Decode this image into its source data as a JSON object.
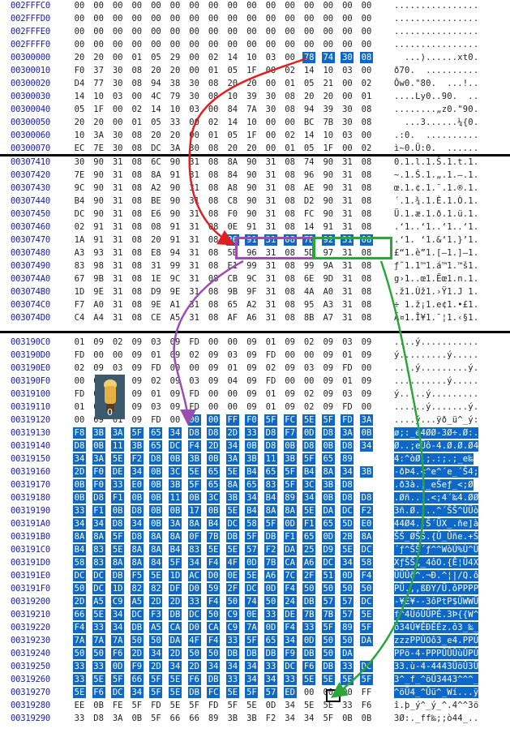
{
  "panel1": {
    "rows": [
      {
        "off": "002FFFC0",
        "bytes": "00 00 00 00 00 00 00 00 00 00 00 00 00 00 00 00",
        "ascii": "................"
      },
      {
        "off": "002FFFD0",
        "bytes": "00 00 00 00 00 00 00 00 00 00 00 00 00 00 00 00",
        "ascii": "................"
      },
      {
        "off": "002FFFE0",
        "bytes": "00 00 00 00 00 00 00 00 00 00 00 00 00 00 00 00",
        "ascii": "................"
      },
      {
        "off": "002FFFF0",
        "bytes": "00 00 00 00 00 00 00 00 00 00 00 00 00 00 00 00",
        "ascii": "................"
      },
      {
        "off": "00300000",
        "bytes": "20 20 00 01 05 29 00 02 14 10 03 00 78 74 30 08",
        "ascii": "  ...)......xt0.",
        "hl_from": 12,
        "asc_hl": "xt0."
      },
      {
        "off": "00300010",
        "bytes": "F0 37 30 08 20 20 00 01 05 1F 00 02 14 10 03 00",
        "ascii": "ð70.  .........."
      },
      {
        "off": "00300020",
        "bytes": "D4 77 30 08 94 38 30 08 20 20 00 01 05 21 00 02",
        "ascii": "Ôw0.\"80.  ...!.."
      },
      {
        "off": "00300030",
        "bytes": "14 10 03 00 4C 79 30 08 10 39 30 08 20 20 00 01",
        "ascii": "....Ly0..90.  .."
      },
      {
        "off": "00300040",
        "bytes": "05 1F 00 02 14 10 03 00 84 7A 30 08 94 39 30 08",
        "ascii": "........„z0.\"90."
      },
      {
        "off": "00300050",
        "bytes": "20 20 00 01 05 33 00 02 14 10 00 00 BC 7B 30 08",
        "ascii": "  ...3......¼{0."
      },
      {
        "off": "00300060",
        "bytes": "10 3A 30 08 20 20 00 01 05 1F 00 02 14 10 03 00",
        "ascii": ".:0.  .........."
      },
      {
        "off": "00300070",
        "bytes": "EC 7E 30 08 DC 3A 30 08 20 20 00 01 05 1F 00 02",
        "ascii": "ì~0.Ü:0.  ......"
      }
    ]
  },
  "panel2": {
    "rows": [
      {
        "off": "00307410",
        "bytes": "30 90 31 08 6C 90 31 08 8A 90 31 08 74 90 31 08",
        "ascii": "0.1.l.1.Š.1.t.1."
      },
      {
        "off": "00307420",
        "bytes": "7E 90 31 08 8A 91 31 08 84 90 31 08 96 90 31 08",
        "ascii": "~.1.Š.1.„.1.–.1."
      },
      {
        "off": "00307430",
        "bytes": "9C 90 31 08 A2 90 31 08 A8 90 31 08 AE 90 31 08",
        "ascii": "œ.1.¢.1.¨.1.®.1."
      },
      {
        "off": "00307440",
        "bytes": "B4 90 31 08 BE 90 31 08 C8 90 31 08 D2 90 31 08",
        "ascii": "´.1.¾.1.È.1.Ò.1."
      },
      {
        "off": "00307450",
        "bytes": "DC 90 31 08 E6 90 31 08 F0 90 31 08 FC 90 31 08",
        "ascii": "Ü.1.æ.1.ð.1.ü.1."
      },
      {
        "off": "00307460",
        "bytes": "02 91 31 08 08 91 31 08 0E 91 31 08 14 91 31 08",
        "ascii": ".‘1..‘1..‘1..‘1."
      },
      {
        "off": "00307470",
        "bytes": "1A 91 31 08 20 91 31 08 26 91 31 08 7D 92 31 08",
        "ascii": ".‘1. ‘1.&‘1.}’1.",
        "hl_from": 8,
        "asc_hl": "&‘1.}’1."
      },
      {
        "off": "00307480",
        "bytes": "A3 93 31 08 E8 94 31 08 5B 96 31 08 5D 97 31 08",
        "ascii": "£“1.è”1.[–1.]—1."
      },
      {
        "off": "00307490",
        "bytes": "83 98 31 08 31 99 31 08 E1 99 31 08 99 9A 31 08",
        "ascii": "ƒ˜1.1™1.á™1.™š1."
      },
      {
        "off": "003074A0",
        "bytes": "67 9B 31 08 1E 9C 31 08 CB 9C 31 08 6E 9D 31 08",
        "ascii": "g›1..œ1.Ëœ1.n.1."
      },
      {
        "off": "003074B0",
        "bytes": "1D 9E 31 08 D9 9E 31 08 9B 9F 31 08 4A A0 31 08",
        "ascii": ".ž1.Ùž1.›Ÿ1.J 1."
      },
      {
        "off": "003074C0",
        "bytes": "F7 A0 31 08 9E A1 31 08 65 A2 31 08 95 A3 31 08",
        "ascii": "÷ 1.ž¡1.e¢1.•£1."
      },
      {
        "off": "003074D0",
        "bytes": "C4 A4 31 08 CE A5 31 08 AF A6 31 08 8B A7 31 08",
        "ascii": "Ä¤1.Î¥1.¯¦1.‹§1."
      }
    ]
  },
  "panel3": {
    "rows": [
      {
        "off": "003190C0",
        "bytes": "01 09 02 09 03 09 FD 00 00 09 01 09 02 09 03 09",
        "ascii": "....ý..........."
      },
      {
        "off": "003190D0",
        "bytes": "FD 00 00 09 01 09 02 09 03 09 FD 00 00 09 01 09",
        "ascii": "ý.........ý....."
      },
      {
        "off": "003190E0",
        "bytes": "02 09 03 09 FD 00 00 09 01 09 02 09 03 09 FD 00",
        "ascii": "....ý.........ý."
      },
      {
        "off": "003190F0",
        "bytes": "00 09 01 09 02 09 03 09 04 09 FD 00 00 09 01 09",
        "ascii": "..........ý....."
      },
      {
        "off": "00319100",
        "bytes": "FD 00 00 09 01 09 FD 00 00 09 01 09 02 09 03 09",
        "ascii": "ý.....ý........."
      },
      {
        "off": "00319110",
        "bytes": "01 09 02 09 03 09 FD 00 00 09 01 09 02 09 FD 00",
        "ascii": "......ý.......ý."
      },
      {
        "off": "00319120",
        "bytes": "00 09 01 09 FD 00 00 00 FF F0 5F FC 5E 5F FD 3A",
        "ascii": "....ý...ÿð_ü^_ý:",
        "hl_from": 6
      },
      {
        "off": "00319130",
        "bytes": "F8 3B 3A 5F 65 34 D8 D8 2D 33 D8 F7 0D D8 3A 0B",
        "ascii": "ø;:_e4ØØ-3Ø÷.Ø:.",
        "hl_from": 0
      },
      {
        "off": "00319140",
        "bytes": "D8 0B 11 3B 65 DC F4 2D 34 0B D8 0B D8 0B D8 34",
        "ascii": "Ø..;eÜô-4.Ø.Ø.Ø4",
        "hl_from": 0
      },
      {
        "off": "00319150",
        "bytes": "34 3A 5E F2 D8 0B 3B 0B 3A 3B 11 3B 5F 65 89",
        "ascii": "4:^òØ.;.:;.;_e‰",
        "hl_from": 0
      },
      {
        "off": "00319160",
        "bytes": "2D F0 DE 34 0B 3C 5E 65 5E B4 65 5F B4 8A 34 3B",
        "ascii": "-ðÞ4.<^e^´e_´Š4;",
        "hl_from": 0
      },
      {
        "off": "00319170",
        "bytes": "0B F0 33 E0 0B 3B 5F 65 8A 65 83 5F 3C 3B D8 ",
        "ascii": ".ð3à.;_eŠeƒ_<;Ø",
        "hl_from": 0
      },
      {
        "off": "00319180",
        "bytes": "0B D8 F1 0B 0B 11 0B 3C 3B 34 B4 89 34 0B D8 D8",
        "ascii": ".Øñ....<;4´‰4.ØØ",
        "hl_from": 0
      },
      {
        "off": "00319190",
        "bytes": "33 F1 0B D8 0B 0B 17 0B 5E B4 8A 8A 5E DA DC F2",
        "ascii": "3ñ.Ø....^´ŠŠ^ÚÜò",
        "hl_from": 0
      },
      {
        "off": "003191A0",
        "bytes": "34 34 D8 34 0B 3A 8A B4 DC 58 5F 0D F1 65 5D E0",
        "ascii": "44Ø4.:Š´ÜX_.ñe]à",
        "hl_from": 0
      },
      {
        "off": "003191B0",
        "bytes": "8A 8A 5F D8 8A 8A 0F 7B DB 5F DB F1 65 0D 2B 8A",
        "ascii": "ŠŠ_ØŠŠ.{Û_Ûñe.+Š",
        "hl_from": 0
      },
      {
        "off": "003191C0",
        "bytes": "B4 83 5E 8A 8A B4 83 5E 5E 57 F2 DA 25 D9 5E DC",
        "ascii": "´ƒ^ŠŠ´ƒ^^WòÚ%Ù^Ü",
        "hl_from": 0
      },
      {
        "off": "003191D0",
        "bytes": "58 83 8A 8A 84 5F 34 F4 4F 0D 7B CA A6 DC 34 58",
        "ascii": "XƒŠŠ„_4ôO.{Ê¦Ü4X",
        "hl_from": 0
      },
      {
        "off": "003191E0",
        "bytes": "DC DC DB F5 5E 1D AC D0 0E 5E A6 7C 2F 51 0D F4",
        "ascii": "ÜÜÛõ^.¬Ð.^¦|/Q.ô",
        "hl_from": 0
      },
      {
        "off": "003191F0",
        "bytes": "50 DC 1D 82 82 DF D0 59 2F DC 0D F4 50 50 50 50",
        "ascii": "PÜ.‚‚ßÐY/Ü.ôPPPP",
        "hl_from": 0
      },
      {
        "off": "00319200",
        "bytes": "2D A5 C9 A5 2D 2D 33 F4 50 74 50 24 DB 57 57 DC",
        "ascii": "-¥É¥--3ôPtP$ÛWWÜ",
        "hl_from": 0
      },
      {
        "off": "00319210",
        "bytes": "66 5E 34 DC F3 DB DC 50 C9 0E 33 DE 7B 7B 57 5E",
        "ascii": "f^4ÜóÛÜPÉ.3Þ{{W^",
        "hl_from": 0
      },
      {
        "off": "00319220",
        "bytes": "F4 33 34 DB A5 CA D0 CA C9 7A 0D F4 33 5F 89 5F",
        "ascii": "ô34Û¥ÊÐÊÉz.ô3_‰_",
        "hl_from": 0
      },
      {
        "off": "00319230",
        "bytes": "7A 7A 7A 50 50 DA 4F F4 33 5F 65 34 0D 50 50 DA",
        "ascii": "zzzPPÚOô3_e4.PPÚ",
        "hl_from": 0
      },
      {
        "off": "00319240",
        "bytes": "50 50 F6 2D 34 2D 50 50 DB DB DB F9 DB 50 DA",
        "ascii": "PPö-4-PPPÛÛÛùÛPÚ",
        "hl_from": 0
      },
      {
        "off": "00319250",
        "bytes": "33 33 0D F9 2D 34 2D 34 34 34 33 DC F6 DB 33 DC",
        "ascii": "33.ù-4-4443ÜöÛ3Ü",
        "hl_from": 0
      },
      {
        "off": "00319260",
        "bytes": "33 5E 5F 66 5F 5E F6 DB 33 34 34 33 5E 5E 5E 5F",
        "ascii": "3^_f_^öÛ3443^^^_",
        "hl_from": 0
      },
      {
        "off": "00319270",
        "bytes": "5E F6 DC 34 5F 5E DB FC 5E 5F 57 ED 00 00 00 FF",
        "ascii": "^öÜ4_^Ûü^_Wí...ÿ",
        "hl_to": 12
      },
      {
        "off": "00319280",
        "bytes": "EE 0B FE 5F FD 5E 5F FD 5F 5E 0D 34 5E 5E 33 F6",
        "ascii": "î.þ_ý^_ý_^.4^^3ö"
      },
      {
        "off": "00319290",
        "bytes": "33 D8 3A 0B 5F 66 66 89 3B 3B F2 34 34 5F 0B 0B",
        "ascii": "3Ø:._ff‰;;ò44_.."
      }
    ]
  },
  "sprite": {
    "label": "0"
  },
  "colors": {
    "highlight": "#0e68c8",
    "offset": "#1a1aaa",
    "red": "#e02020",
    "purple": "#9a4fb0",
    "green": "#2aa63a"
  }
}
